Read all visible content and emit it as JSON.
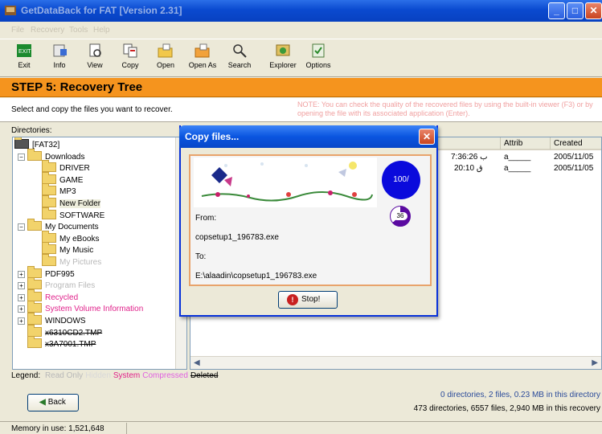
{
  "window": {
    "title": "GetDataBack for FAT [Version 2.31]",
    "colors": {
      "titlebar": "#0a4ad0",
      "step_banner": "#f5941e",
      "dialog_border": "#0831d9"
    }
  },
  "menu": [
    "File",
    "Recovery",
    "Tools",
    "Help"
  ],
  "toolbar": [
    {
      "label": "Exit",
      "icon": "exit-icon"
    },
    {
      "label": "Info",
      "icon": "info-icon"
    },
    {
      "label": "View",
      "icon": "view-icon"
    },
    {
      "label": "Copy",
      "icon": "copy-icon"
    },
    {
      "label": "Open",
      "icon": "open-icon"
    },
    {
      "label": "Open As",
      "icon": "open-as-icon"
    },
    {
      "label": "Search",
      "icon": "search-icon"
    },
    {
      "label": "Explorer",
      "icon": "explorer-icon"
    },
    {
      "label": "Options",
      "icon": "options-icon"
    }
  ],
  "step": {
    "title": "STEP 5: Recovery Tree"
  },
  "instruction": "Select and copy the files you want to recover.",
  "note": "NOTE: You can check the quality of the recovered files by using the built-in viewer (F3) or by opening the file with its associated application (Enter).",
  "directories_label": "Directories:",
  "tree": [
    {
      "label": "[FAT32]",
      "level": 0,
      "expander": ""
    },
    {
      "label": "Downloads",
      "level": 1,
      "expander": "−"
    },
    {
      "label": "DRIVER",
      "level": 2,
      "expander": ""
    },
    {
      "label": "GAME",
      "level": 2,
      "expander": ""
    },
    {
      "label": "MP3",
      "level": 2,
      "expander": ""
    },
    {
      "label": "New Folder",
      "level": 2,
      "expander": "",
      "selected": true
    },
    {
      "label": "SOFTWARE",
      "level": 2,
      "expander": ""
    },
    {
      "label": "My Documents",
      "level": 1,
      "expander": "−"
    },
    {
      "label": "My eBooks",
      "level": 2,
      "expander": ""
    },
    {
      "label": "My Music",
      "level": 2,
      "expander": ""
    },
    {
      "label": "My Pictures",
      "level": 2,
      "expander": "",
      "color": "#b8b8b8"
    },
    {
      "label": "PDF995",
      "level": 1,
      "expander": "+"
    },
    {
      "label": "Program Files",
      "level": 1,
      "expander": "+",
      "color": "#b8b8b8"
    },
    {
      "label": "Recycled",
      "level": 1,
      "expander": "+",
      "color": "#e0208a"
    },
    {
      "label": "System Volume Information",
      "level": 1,
      "expander": "+",
      "color": "#e0208a"
    },
    {
      "label": "WINDOWS",
      "level": 1,
      "expander": "+"
    },
    {
      "label": "x6310CD2.TMP",
      "level": 1,
      "expander": "",
      "strike": true
    },
    {
      "label": "x3A7001.TMP",
      "level": 1,
      "expander": "",
      "strike": true
    }
  ],
  "list": {
    "columns": [
      "Attrib",
      "Created"
    ],
    "rows": [
      {
        "modified": "7:36:26 ب",
        "attrib": "a_____",
        "created": "2005/11/05"
      },
      {
        "modified": "20:10 ق",
        "attrib": "a_____",
        "created": "2005/11/05"
      }
    ]
  },
  "legend": {
    "label": "Legend:",
    "items": [
      {
        "text": "Read Only",
        "color": "#b8b8b8"
      },
      {
        "text": "Hidden",
        "color": "#d9d9d9"
      },
      {
        "text": "System",
        "color": "#e0208a"
      },
      {
        "text": "Compressed",
        "color": "#e060e0"
      },
      {
        "text": "Deleted",
        "color": "#000000"
      }
    ]
  },
  "back_label": "Back",
  "summary": [
    "0 directories, 2 files, 0.23 MB in this directory",
    "473 directories, 6557 files, 2,940 MB in this recovery"
  ],
  "status": {
    "memory": "Memory in use: 1,521,648"
  },
  "dialog": {
    "title": "Copy files...",
    "from_label": "From:",
    "from_value": "copsetup1_196783.exe",
    "to_label": "To:",
    "to_value": "E:\\alaadin\\copsetup1_196783.exe",
    "percent": "100/",
    "sub_percent": "36",
    "progress_fraction": 1.0,
    "sub_progress_fraction": 0.36,
    "stop_label": "Stop!"
  }
}
